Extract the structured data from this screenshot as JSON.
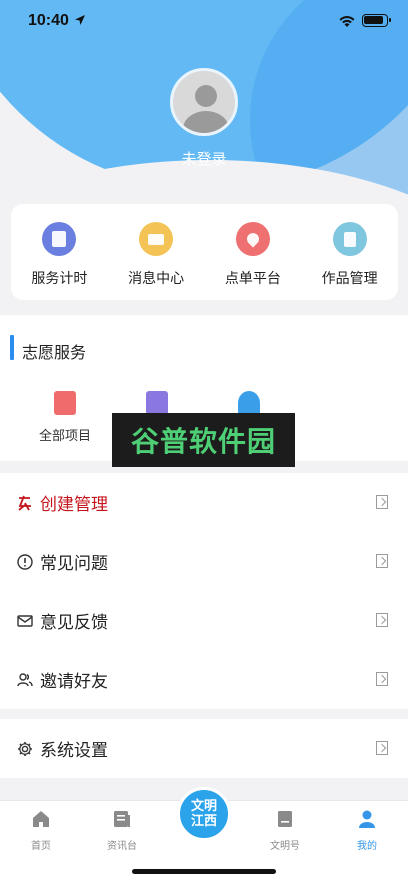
{
  "status_bar": {
    "time": "10:40"
  },
  "profile": {
    "login_label": "未登录"
  },
  "quick_actions": [
    {
      "label": "服务计时",
      "icon": "timer-doc-icon",
      "color": "#6b7fe0"
    },
    {
      "label": "消息中心",
      "icon": "message-icon",
      "color": "#f3c455"
    },
    {
      "label": "点单平台",
      "icon": "location-pin-icon",
      "color": "#ee7070"
    },
    {
      "label": "作品管理",
      "icon": "works-icon",
      "color": "#7fc7de"
    }
  ],
  "volunteer": {
    "title": "志愿服务",
    "items": [
      {
        "label": "全部项目",
        "icon": "project-list-icon",
        "color": "#f06c6c"
      },
      {
        "label": "",
        "icon": "clipboard-icon",
        "color": "#8a78e0"
      },
      {
        "label": "",
        "icon": "volunteer-person-icon",
        "color": "#3a9ee8"
      }
    ]
  },
  "watermark": {
    "text": "谷普软件园"
  },
  "menu": [
    {
      "label": "创建管理",
      "icon": "create-manage-icon",
      "highlight": true
    },
    {
      "label": "常见问题",
      "icon": "info-circle-icon"
    },
    {
      "label": "意见反馈",
      "icon": "mail-icon"
    },
    {
      "label": "邀请好友",
      "icon": "friends-icon"
    }
  ],
  "settings": {
    "label": "系统设置",
    "icon": "gear-icon"
  },
  "tabbar": {
    "tabs": [
      {
        "label": "首页",
        "icon": "home-icon",
        "active": false
      },
      {
        "label": "资讯台",
        "icon": "news-icon",
        "active": false
      },
      {
        "label": "文明号",
        "icon": "civilization-icon",
        "active": false
      },
      {
        "label": "我的",
        "icon": "user-icon",
        "active": true
      }
    ],
    "center": {
      "line1": "文明",
      "line2": "江西"
    }
  },
  "colors": {
    "primary": "#63b9f4",
    "accent": "#2b8df0",
    "active_tab": "#3596e8",
    "highlight_red": "#c4161c"
  }
}
